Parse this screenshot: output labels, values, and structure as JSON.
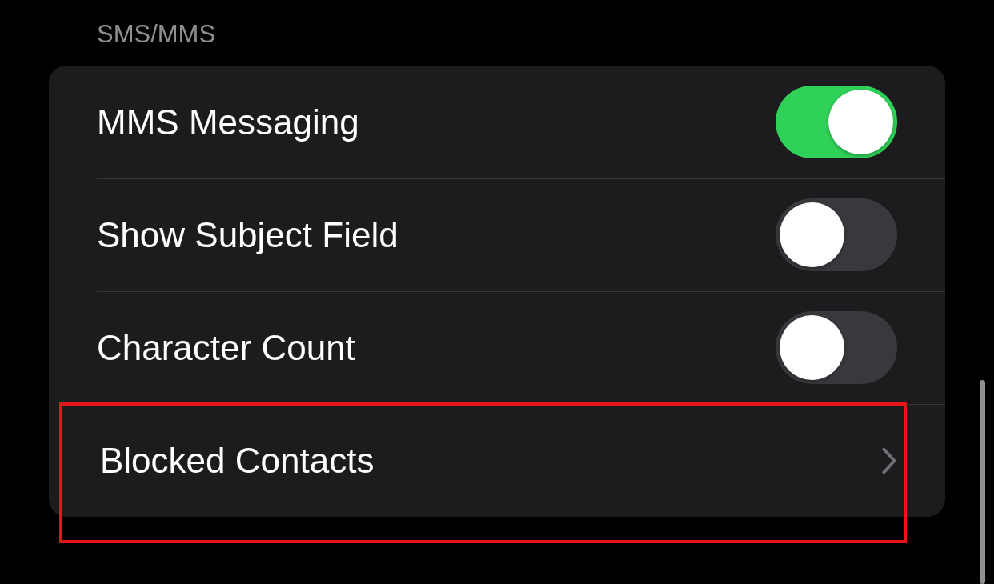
{
  "section_header": "SMS/MMS",
  "rows": [
    {
      "kind": "toggle",
      "label": "MMS Messaging",
      "on": true,
      "highlighted": false
    },
    {
      "kind": "toggle",
      "label": "Show Subject Field",
      "on": false,
      "highlighted": false
    },
    {
      "kind": "toggle",
      "label": "Character Count",
      "on": false,
      "highlighted": false
    },
    {
      "kind": "link",
      "label": "Blocked Contacts",
      "highlighted": true
    }
  ]
}
